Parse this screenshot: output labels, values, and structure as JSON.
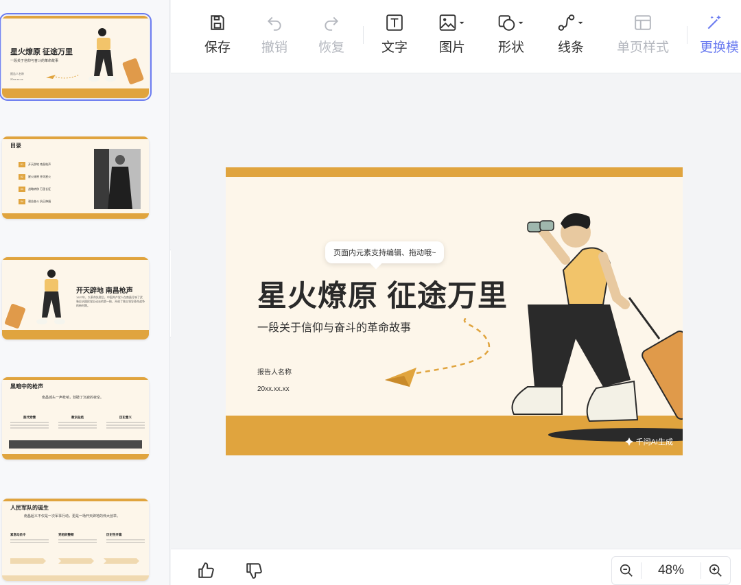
{
  "toolbar": {
    "save": "保存",
    "undo": "撤销",
    "redo": "恢复",
    "text": "文字",
    "image": "图片",
    "shape": "形状",
    "line": "线条",
    "page_style": "单页样式",
    "change_template": "更换模"
  },
  "slide": {
    "title": "星火燎原 征途万里",
    "subtitle": "一段关于信仰与奋斗的革命故事",
    "reporter": "报告人名称",
    "date": "20xx.xx.xx",
    "watermark": "千问AI生成",
    "tooltip": "页面内元素支持编辑、拖动哦~"
  },
  "thumbnails": {
    "t1": {
      "title": "星火燎原 征途万里",
      "sub": "一段关于信仰与奋斗的革命故事",
      "reporter": "报告人名称",
      "date": "20xx.xx.xx"
    },
    "t2": {
      "title": "目录",
      "items": [
        {
          "num": "01",
          "label": "开天辟地 南昌枪声"
        },
        {
          "num": "02",
          "label": "星火燎原 井冈星火"
        },
        {
          "num": "03",
          "label": "战略转移 万里长征"
        },
        {
          "num": "04",
          "label": "艰苦奋斗 抗日烽烟"
        }
      ]
    },
    "t3": {
      "title": "开天辟地 南昌枪声",
      "body": "1927年，大革命失败后，中国共产党人在南昌打响了武装反抗国民党反动派的第一枪，开创了独立领导革命战争的新时期。"
    },
    "t4": {
      "title": "黑暗中的枪声",
      "sub": "南昌城头一声枪响，划破了沉寂的夜空。",
      "cols": [
        "敌代党情",
        "教训总结",
        "历史意义"
      ]
    },
    "t5": {
      "title": "人民军队的诞生",
      "sub": "南昌起义不仅是一次军事行动，更是一场开天辟地的伟大创举。",
      "cols": [
        "紧急动员令",
        "党组织整顿",
        "历史性开篇"
      ]
    }
  },
  "zoom": {
    "value": "48%"
  },
  "colors": {
    "accent": "#e0a43e",
    "slide_bg": "#fdf6ea",
    "brand": "#6b7cf0"
  }
}
